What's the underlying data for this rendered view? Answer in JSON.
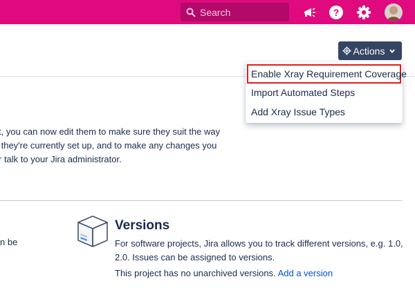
{
  "topbar": {
    "search_placeholder": "Search",
    "icons": [
      "megaphone-icon",
      "help-icon",
      "gear-icon",
      "avatar"
    ],
    "color": "#de0a7e"
  },
  "actions": {
    "label": "Actions",
    "menu": [
      "Enable Xray Requirement Coverage",
      "Import Automated Steps",
      "Add Xray Issue Types"
    ],
    "highlight_color": "#e31b1b"
  },
  "intro": {
    "line1": "t, you can now edit them to make sure they suit the way",
    "line2": " they're currently set up, and to make any changes you",
    "line3": "r talk to your Jira administrator."
  },
  "left_fragment": "n be",
  "versions": {
    "title": "Versions",
    "description": "For software projects, Jira allows you to track different versions, e.g. 1.0, 2.0. Issues can be assigned to versions.",
    "note": "This project has no unarchived versions.",
    "link": "Add a version"
  }
}
